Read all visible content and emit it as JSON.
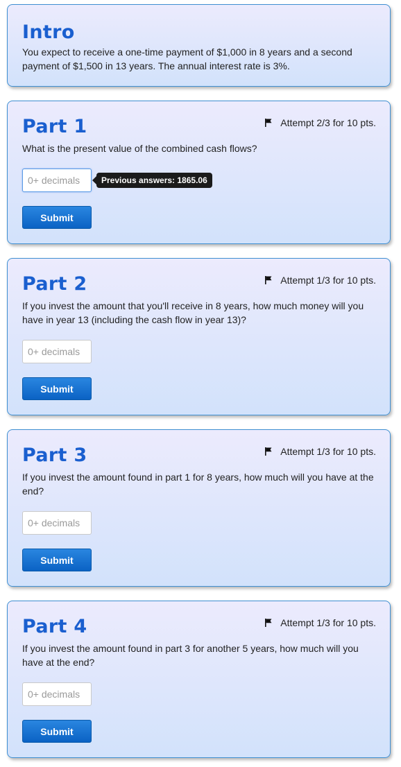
{
  "intro": {
    "title": "Intro",
    "text": "You expect to receive a one-time payment of $1,000 in 8 years and a second payment of $1,500 in 13 years. The annual interest rate is 3%."
  },
  "parts": [
    {
      "title": "Part 1",
      "attempt": "Attempt 2/3 for 10 pts.",
      "question": "What is the present value of the combined cash flows?",
      "input_placeholder": "0+ decimals",
      "input_value": "",
      "tooltip": "Previous answers: 1865.06",
      "submit_label": "Submit"
    },
    {
      "title": "Part 2",
      "attempt": "Attempt 1/3 for 10 pts.",
      "question": "If you invest the amount that you'll receive in 8 years, how much money will you have in year 13 (including the cash flow in year 13)?",
      "input_placeholder": "0+ decimals",
      "input_value": "",
      "submit_label": "Submit"
    },
    {
      "title": "Part 3",
      "attempt": "Attempt 1/3 for 10 pts.",
      "question": "If you invest the amount found in part 1 for 8 years, how much will you have at the end?",
      "input_placeholder": "0+ decimals",
      "input_value": "",
      "submit_label": "Submit"
    },
    {
      "title": "Part 4",
      "attempt": "Attempt 1/3 for 10 pts.",
      "question": "If you invest the amount found in part 3 for another 5 years, how much will you have at the end?",
      "input_placeholder": "0+ decimals",
      "input_value": "",
      "submit_label": "Submit"
    }
  ],
  "icons": {
    "attempt_icon": "flag-icon"
  },
  "colors": {
    "title": "#1a5fcf",
    "card_border": "#3f8fd2",
    "button": "#0b62c4",
    "tooltip_bg": "#1b1b1b"
  }
}
